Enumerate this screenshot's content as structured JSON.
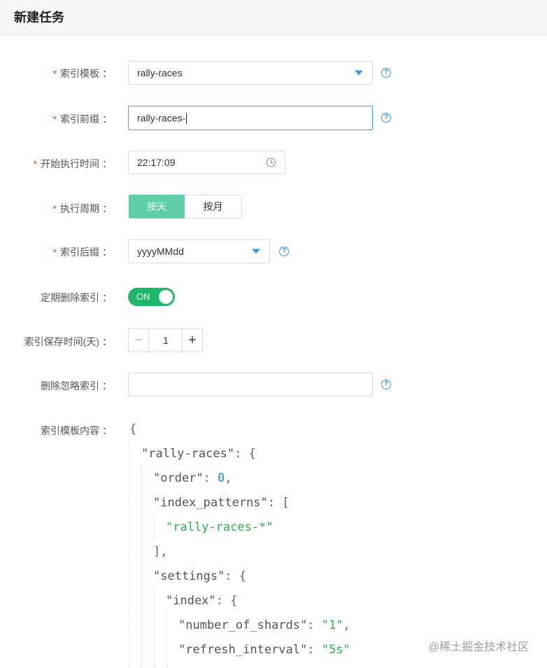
{
  "header": {
    "title": "新建任务"
  },
  "form": {
    "required_mark": "*",
    "colon": "：",
    "index_template": {
      "label": "索引模板",
      "value": "rally-races",
      "help": "?"
    },
    "index_prefix": {
      "label": "索引前缀",
      "value": "rally-races-",
      "help": "?"
    },
    "start_time": {
      "label": "开始执行时间",
      "value": "22:17:09"
    },
    "period": {
      "label": "执行周期",
      "options": [
        "按天",
        "按月"
      ],
      "selected": "按天"
    },
    "index_suffix": {
      "label": "索引后缀",
      "value": "yyyyMMdd",
      "help": "?"
    },
    "delete_toggle": {
      "label": "定期删除索引",
      "state": "ON"
    },
    "retention": {
      "label": "索引保存时间(天)",
      "value": "1",
      "minus": "−",
      "plus": "+"
    },
    "ignore_delete": {
      "label": "删除忽略索引",
      "value": "",
      "help": "?"
    },
    "template_content": {
      "label": "索引模板内容"
    }
  },
  "json_lines": [
    {
      "open": "{"
    },
    {
      "key": "\"rally-races\"",
      "sep": ": ",
      "rest": "{"
    },
    {
      "key": "\"order\"",
      "sep": ": ",
      "num": "0",
      "rest": ","
    },
    {
      "key": "\"index_patterns\"",
      "sep": ": ",
      "rest": "["
    },
    {
      "str": "\"rally-races-*\""
    },
    {
      "rest": "],"
    },
    {
      "key": "\"settings\"",
      "sep": ": ",
      "rest": "{"
    },
    {
      "key": "\"index\"",
      "sep": ": ",
      "rest": "{"
    },
    {
      "key": "\"number_of_shards\"",
      "sep": ": ",
      "str": "\"1\"",
      "rest": ","
    },
    {
      "key": "\"refresh_interval\"",
      "sep": ": ",
      "str": "\"5s\""
    }
  ],
  "watermark": "@稀土掘金技术社区",
  "colors": {
    "accent_blue": "#3a9be6",
    "segment_active": "#5fcfa5",
    "toggle_on": "#1fb86a",
    "required": "#e64545",
    "json_string": "#2bb34b",
    "json_number": "#1e88d6"
  }
}
